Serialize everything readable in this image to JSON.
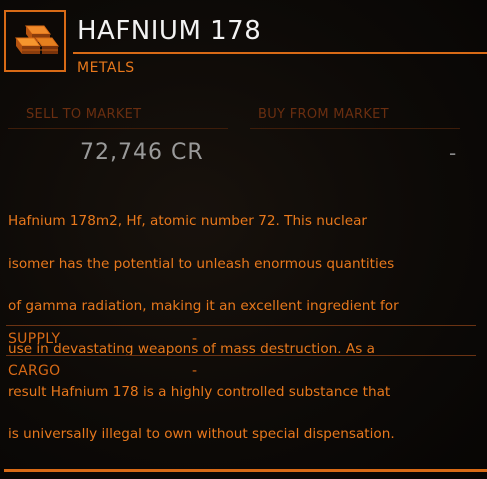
{
  "item": {
    "name": "HAFNIUM 178",
    "category": "METALS",
    "icon": "gold-bars-icon"
  },
  "market": {
    "sell_label": "SELL TO MARKET",
    "sell_value": "72,746 CR",
    "buy_label": "BUY FROM MARKET",
    "buy_value": "-"
  },
  "description_lines": [
    "Hafnium 178m2, Hf, atomic number 72. This nuclear",
    "isomer has the potential to unleash enormous quantities",
    "of gamma radiation, making it an excellent ingredient for",
    "use in devastating weapons of mass destruction. As a",
    "result Hafnium 178 is a highly controlled substance that",
    "is universally illegal to own without special dispensation."
  ],
  "stats": {
    "supply_label": "SUPPLY",
    "supply_value": "-",
    "cargo_label": "CARGO",
    "cargo_value": "-"
  },
  "colors": {
    "accent": "#d86a16",
    "text_orange": "#e8781c",
    "title": "#f2f2f2",
    "muted_label": "#6a2e10",
    "value_grey": "#9a9a9a",
    "background": "#0b0806"
  }
}
